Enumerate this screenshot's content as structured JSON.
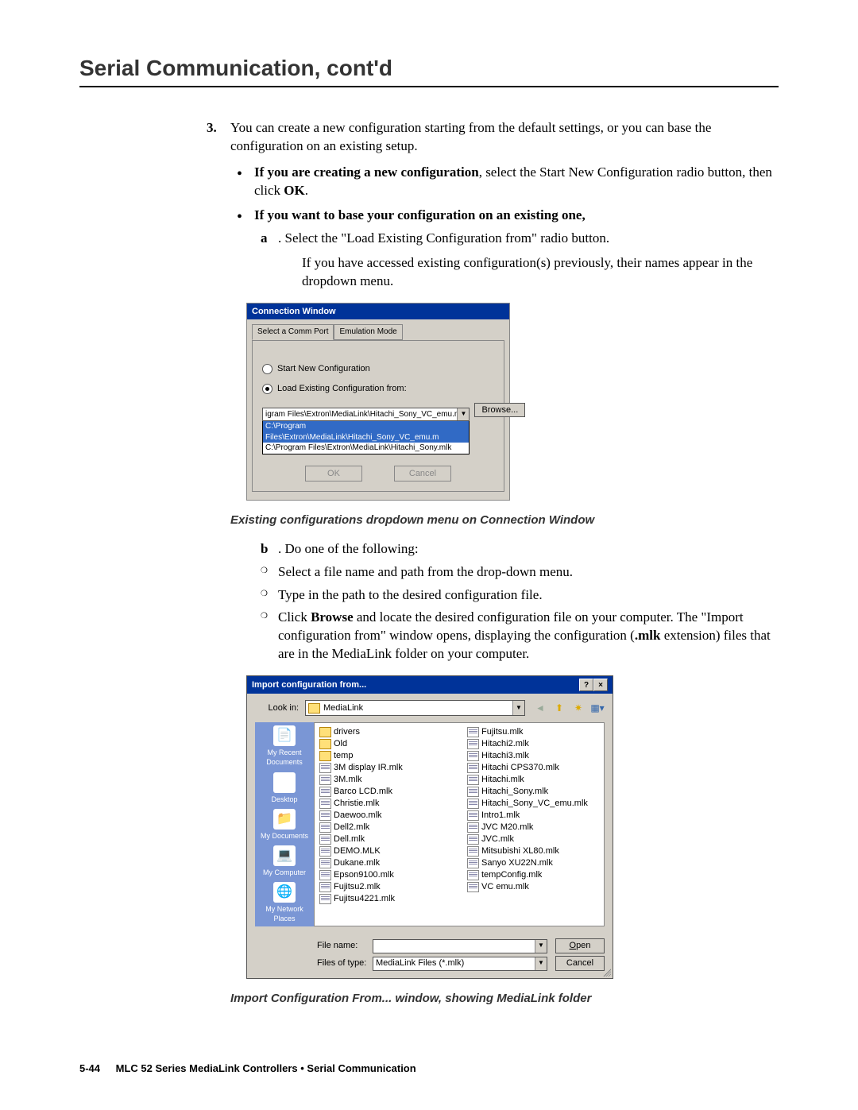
{
  "page_title": "Serial Communication, cont'd",
  "step": {
    "num": "3.",
    "text_a": "You can create a new configuration starting from the default settings, or you can base the configuration on an existing setup.",
    "b1_bold": "If you are creating a new configuration",
    "b1_rest": ", select the Start New Configuration radio button, then click ",
    "b1_ok": "OK",
    "b1_end": ".",
    "b2_bold": "If you want to base your configuration on an existing one,",
    "sub_a_label": "a",
    "sub_a_text": ".   Select the \"Load Existing Configuration from\" radio button.",
    "sub_a_follow": "If you have accessed existing configuration(s) previously, their names appear in the dropdown menu."
  },
  "conn": {
    "title": "Connection Window",
    "tab1": "Select a Comm Port",
    "tab2": "Emulation Mode",
    "radio1": "Start New Configuration",
    "radio2": "Load Existing Configuration from:",
    "combo_sel": "igram Files\\Extron\\MediaLink\\Hitachi_Sony_VC_emu.mlk",
    "combo_opt1": "C:\\Program Files\\Extron\\MediaLink\\Hitachi_Sony_VC_emu.m",
    "combo_opt2": "C:\\Program Files\\Extron\\MediaLink\\Hitachi_Sony.mlk",
    "browse": "Browse...",
    "ok": "OK",
    "cancel": "Cancel"
  },
  "caption1": "Existing configurations dropdown menu on Connection Window",
  "part_b": {
    "label": "b",
    "text": ".   Do one of the following:",
    "c1": "Select a file name and path from the drop-down menu.",
    "c2": "Type in the path to the desired configuration file.",
    "c3_a": "Click ",
    "c3_browse": "Browse",
    "c3_b": " and locate the desired configuration file on your computer.  The \"Import configuration from\" window opens, displaying the configuration (",
    "c3_ext": ".mlk",
    "c3_c": " extension) files that are in the MediaLink folder on your computer."
  },
  "import": {
    "title": "Import configuration from...",
    "help": "?",
    "close": "×",
    "look_in": "Look in:",
    "folder": "MediaLink",
    "places": [
      "My Recent Documents",
      "Desktop",
      "My Documents",
      "My Computer",
      "My Network Places"
    ],
    "col1": [
      {
        "t": "folder",
        "n": "drivers"
      },
      {
        "t": "folder",
        "n": "Old"
      },
      {
        "t": "folder",
        "n": "temp"
      },
      {
        "t": "file",
        "n": "3M display IR.mlk"
      },
      {
        "t": "file",
        "n": "3M.mlk"
      },
      {
        "t": "file",
        "n": "Barco LCD.mlk"
      },
      {
        "t": "file",
        "n": "Christie.mlk"
      },
      {
        "t": "file",
        "n": "Daewoo.mlk"
      },
      {
        "t": "file",
        "n": "Dell2.mlk"
      },
      {
        "t": "file",
        "n": "Dell.mlk"
      },
      {
        "t": "file",
        "n": "DEMO.MLK"
      },
      {
        "t": "file",
        "n": "Dukane.mlk"
      },
      {
        "t": "file",
        "n": "Epson9100.mlk"
      },
      {
        "t": "file",
        "n": "Fujitsu2.mlk"
      },
      {
        "t": "file",
        "n": "Fujitsu4221.mlk"
      }
    ],
    "col2": [
      {
        "t": "file",
        "n": "Fujitsu.mlk"
      },
      {
        "t": "file",
        "n": "Hitachi2.mlk"
      },
      {
        "t": "file",
        "n": "Hitachi3.mlk"
      },
      {
        "t": "file",
        "n": "Hitachi CPS370.mlk"
      },
      {
        "t": "file",
        "n": "Hitachi.mlk"
      },
      {
        "t": "file",
        "n": "Hitachi_Sony.mlk"
      },
      {
        "t": "file",
        "n": "Hitachi_Sony_VC_emu.mlk"
      },
      {
        "t": "file",
        "n": "Intro1.mlk"
      },
      {
        "t": "file",
        "n": "JVC M20.mlk"
      },
      {
        "t": "file",
        "n": "JVC.mlk"
      },
      {
        "t": "file",
        "n": "Mitsubishi XL80.mlk"
      },
      {
        "t": "file",
        "n": "Sanyo XU22N.mlk"
      },
      {
        "t": "file",
        "n": "tempConfig.mlk"
      },
      {
        "t": "file",
        "n": "VC emu.mlk"
      }
    ],
    "file_name_lbl": "File name:",
    "file_name_val": "",
    "file_type_lbl": "Files of type:",
    "file_type_val": "MediaLink Files (*.mlk)",
    "open": "Open",
    "cancel": "Cancel"
  },
  "caption2": "Import Configuration From... window, showing MediaLink folder",
  "footer": {
    "page": "5-44",
    "text": "MLC 52 Series MediaLink Controllers • Serial Communication"
  }
}
